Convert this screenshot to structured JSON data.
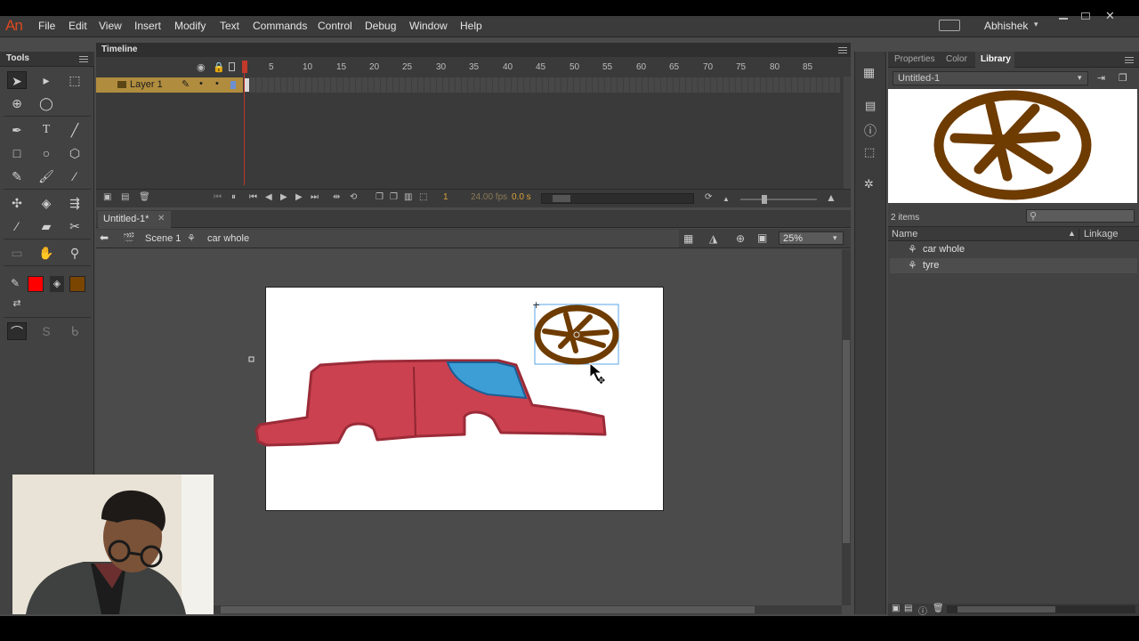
{
  "app": {
    "logo": "An",
    "user": "Abhishek"
  },
  "menu": [
    "File",
    "Edit",
    "View",
    "Insert",
    "Modify",
    "Text",
    "Commands",
    "Control",
    "Debug",
    "Window",
    "Help"
  ],
  "tools": {
    "title": "Tools"
  },
  "timeline": {
    "title": "Timeline",
    "ticks": [
      "1",
      "5",
      "10",
      "15",
      "20",
      "25",
      "30",
      "35",
      "40",
      "45",
      "50",
      "55",
      "60",
      "65",
      "70",
      "75",
      "80",
      "85"
    ],
    "layer_name": "Layer 1",
    "current_frame": "1",
    "fps": "24.00 fps",
    "time": "0.0 s"
  },
  "document": {
    "tab": "Untitled-1*",
    "scene": "Scene 1",
    "symbol": "car whole",
    "zoom": "25%"
  },
  "library": {
    "tabs": [
      "Properties",
      "Color",
      "Library"
    ],
    "doc_select": "Untitled-1",
    "item_count": "2 items",
    "col_name": "Name",
    "col_linkage": "Linkage",
    "items": [
      "car whole",
      "tyre"
    ]
  },
  "colors": {
    "stroke": "#ff0000",
    "fill": "#7a4500",
    "car_body": "#cb4150",
    "window": "#3d9ed6",
    "tyre": "#6e3b00",
    "layer_highlight": "#b08c3e"
  }
}
